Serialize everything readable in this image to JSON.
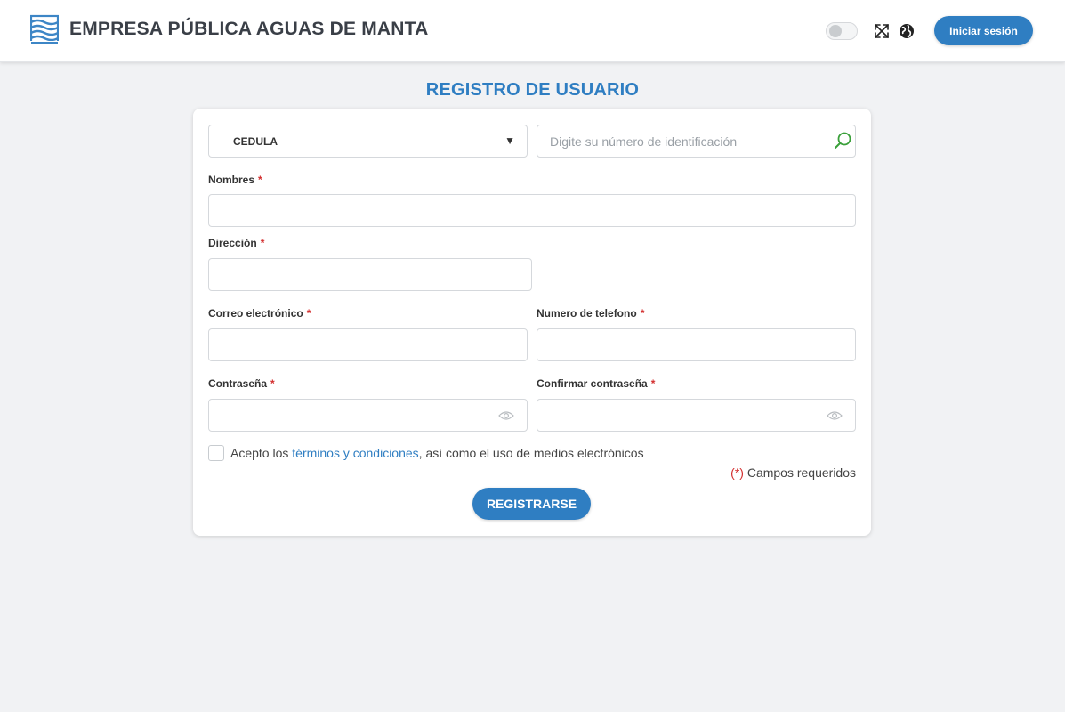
{
  "header": {
    "brand_name": "EMPRESA PÚBLICA AGUAS DE MANTA",
    "logo_icon": "waves-logo-icon",
    "theme_toggle": "toggle-switch",
    "fullscreen_icon": "expand-arrows-icon",
    "language_icon": "globe-icon",
    "login_label": "Iniciar sesión"
  },
  "page": {
    "title": "REGISTRO DE USUARIO"
  },
  "form": {
    "id_type": "CEDULA",
    "id_placeholder": "Digite su número de identificación",
    "search_icon": "search-icon",
    "nombres_label": "Nombres",
    "direccion_label": "Dirección",
    "correo_label": "Correo electrónico",
    "telefono_label": "Numero de telefono",
    "password_label": "Contraseña",
    "confirm_password_label": "Confirmar contraseña",
    "required_mark": "*",
    "terms_prefix": "Acepto los ",
    "terms_link": "términos y condiciones",
    "terms_suffix": ", así como el uso de medios electrónicos",
    "required_note_mark": "(*)",
    "required_note_text": " Campos requeridos",
    "register_label": "REGISTRARSE"
  },
  "colors": {
    "primary": "#2f7ec2",
    "required": "#d32f2f",
    "background": "#f1f2f4",
    "search_icon": "#3aa03a"
  }
}
